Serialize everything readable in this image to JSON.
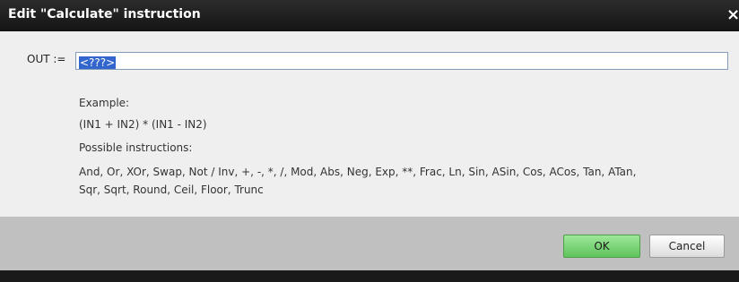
{
  "window": {
    "title": "Edit \"Calculate\" instruction",
    "close_icon": "×"
  },
  "expression": {
    "label": "OUT :=",
    "value": "<???>"
  },
  "help": {
    "example_heading": "Example:",
    "example_text": "(IN1 + IN2) * (IN1 - IN2)",
    "possible_heading": "Possible instructions:",
    "instructions_line1": "And, Or, XOr, Swap, Not / Inv, +, -, *, /, Mod, Abs, Neg, Exp, **, Frac, Ln, Sin, ASin, Cos, ACos, Tan, ATan,",
    "instructions_line2": "Sqr, Sqrt, Round, Ceil, Floor, Trunc"
  },
  "buttons": {
    "ok_label": "OK",
    "cancel_label": "Cancel"
  },
  "colors": {
    "ok_button": "#6fd06a",
    "selection": "#3366cc",
    "title_bar": "#1e1e1e"
  }
}
